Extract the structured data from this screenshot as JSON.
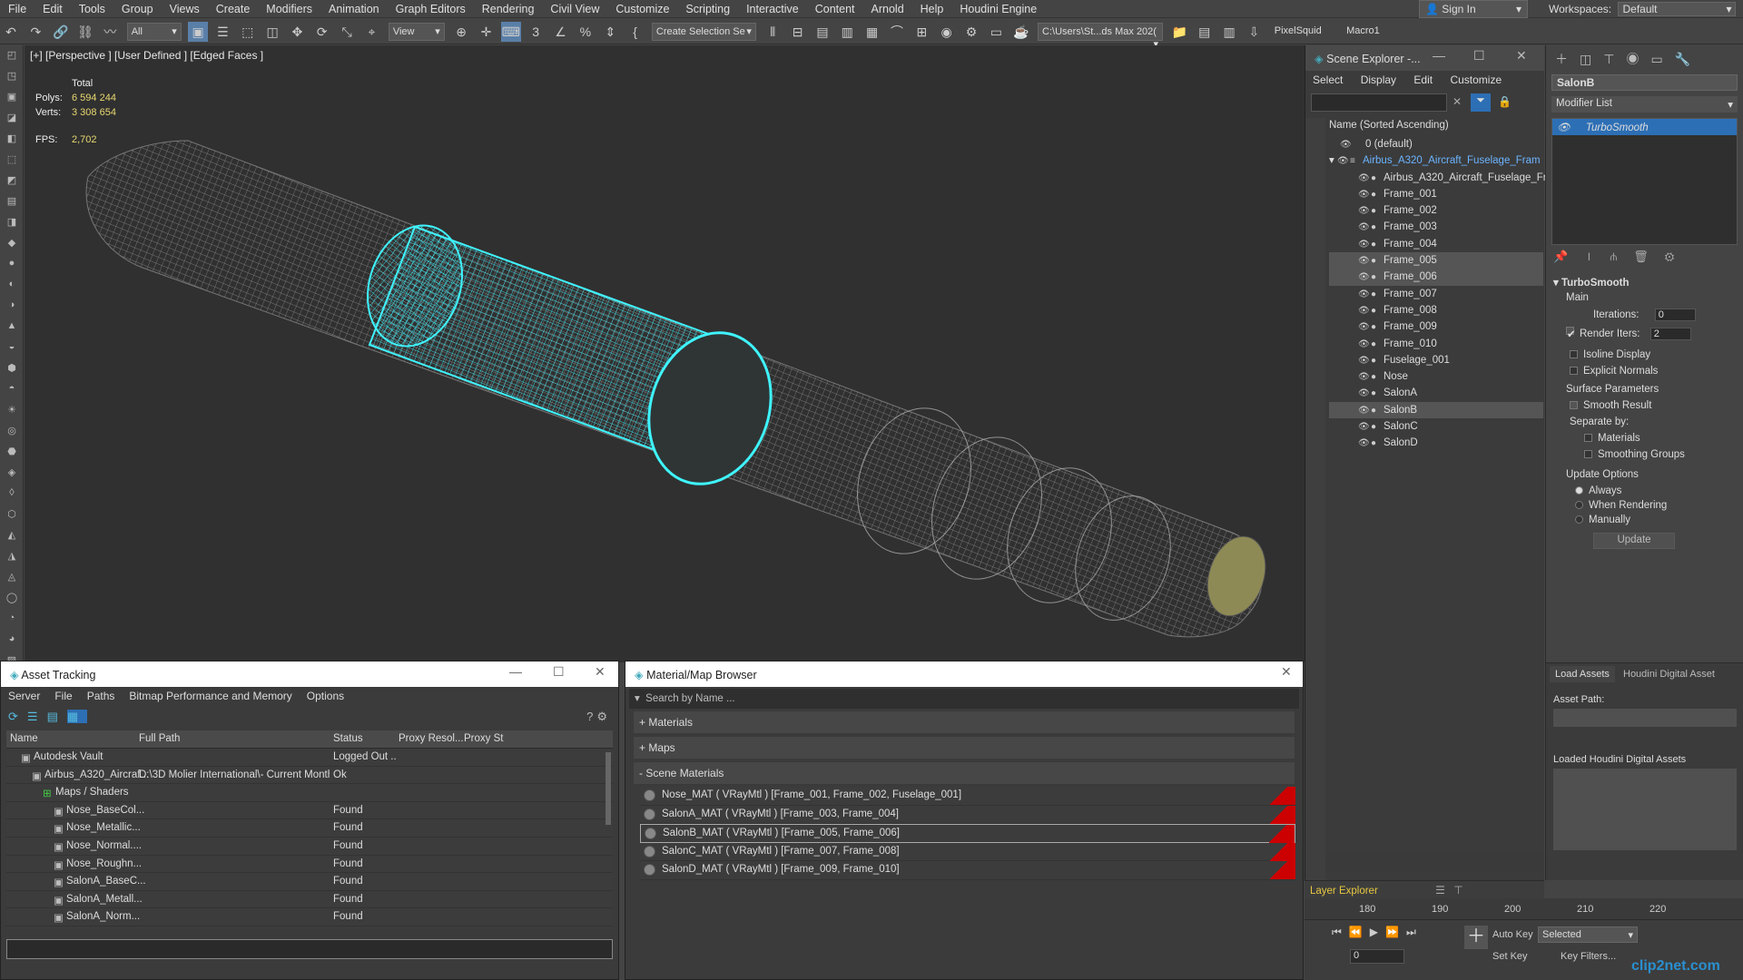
{
  "menu": [
    "File",
    "Edit",
    "Tools",
    "Group",
    "Views",
    "Create",
    "Modifiers",
    "Animation",
    "Graph Editors",
    "Rendering",
    "Civil View",
    "Customize",
    "Scripting",
    "Interactive",
    "Content",
    "Arnold",
    "Help",
    "Houdini Engine"
  ],
  "signin": "Sign In",
  "workspaces": {
    "label": "Workspaces:",
    "value": "Default"
  },
  "toolbar": {
    "filter": "All",
    "refcoord": "View",
    "selset": "Create Selection Se",
    "path": "C:\\Users\\St...ds Max 202(",
    "pixelsquid": "PixelSquid",
    "macro": "Macro1"
  },
  "viewport": {
    "label": "[+] [Perspective ] [User Defined ] [Edged Faces ]",
    "stats_title": "Total",
    "polys_label": "Polys:",
    "polys": "6 594 244",
    "verts_label": "Verts:",
    "verts": "3 308 654",
    "fps_label": "FPS:",
    "fps": "2,702"
  },
  "scene_explorer": {
    "title": "Scene Explorer -...",
    "menu": [
      "Select",
      "Display",
      "Edit",
      "Customize"
    ],
    "header": "Name (Sorted Ascending)",
    "rows": [
      {
        "name": "0 (default)",
        "indent": 0,
        "sel": false
      },
      {
        "name": "Airbus_A320_Aircraft_Fuselage_Fram",
        "indent": 0,
        "sel": false,
        "link": true
      },
      {
        "name": "Airbus_A320_Aircraft_Fuselage_Fr",
        "indent": 1,
        "sel": false
      },
      {
        "name": "Frame_001",
        "indent": 1,
        "sel": false
      },
      {
        "name": "Frame_002",
        "indent": 1,
        "sel": false
      },
      {
        "name": "Frame_003",
        "indent": 1,
        "sel": false
      },
      {
        "name": "Frame_004",
        "indent": 1,
        "sel": false
      },
      {
        "name": "Frame_005",
        "indent": 1,
        "sel": true
      },
      {
        "name": "Frame_006",
        "indent": 1,
        "sel": true
      },
      {
        "name": "Frame_007",
        "indent": 1,
        "sel": false
      },
      {
        "name": "Frame_008",
        "indent": 1,
        "sel": false
      },
      {
        "name": "Frame_009",
        "indent": 1,
        "sel": false
      },
      {
        "name": "Frame_010",
        "indent": 1,
        "sel": false
      },
      {
        "name": "Fuselage_001",
        "indent": 1,
        "sel": false
      },
      {
        "name": "Nose",
        "indent": 1,
        "sel": false
      },
      {
        "name": "SalonA",
        "indent": 1,
        "sel": false
      },
      {
        "name": "SalonB",
        "indent": 1,
        "sel": true
      },
      {
        "name": "SalonC",
        "indent": 1,
        "sel": false
      },
      {
        "name": "SalonD",
        "indent": 1,
        "sel": false
      }
    ],
    "layer_explorer": "Layer Explorer"
  },
  "command_panel": {
    "object_name": "SalonB",
    "modifier_list": "Modifier List",
    "modifier": "TurboSmooth",
    "rollout": "TurboSmooth",
    "main": "Main",
    "iterations_label": "Iterations:",
    "iterations": "0",
    "render_iters_label": "Render Iters:",
    "render_iters": "2",
    "isoline": "Isoline Display",
    "explicit": "Explicit Normals",
    "surface": "Surface Parameters",
    "smooth_result": "Smooth Result",
    "separate_by": "Separate by:",
    "materials": "Materials",
    "smoothing_groups": "Smoothing Groups",
    "update_options": "Update Options",
    "always": "Always",
    "when_rendering": "When Rendering",
    "manually": "Manually",
    "update_btn": "Update",
    "tabs": [
      "Load Assets",
      "Houdini Digital Asset"
    ],
    "asset_path": "Asset Path:",
    "loaded_hda": "Loaded Houdini Digital Assets"
  },
  "timeline": {
    "ticks": [
      "180",
      "190",
      "200",
      "210",
      "220"
    ],
    "autokey": "Auto Key",
    "selected": "Selected",
    "setkey": "Set Key",
    "keyfilters": "Key Filters...",
    "frame": "0"
  },
  "asset_tracking": {
    "title": "Asset Tracking",
    "menu": [
      "Server",
      "File",
      "Paths",
      "Bitmap Performance and Memory",
      "Options"
    ],
    "columns": [
      "Name",
      "Full Path",
      "Status",
      "Proxy Resol...",
      "Proxy St"
    ],
    "rows": [
      {
        "name": "Autodesk Vault",
        "path": "",
        "status": "Logged Out ...",
        "indent": 1
      },
      {
        "name": "Airbus_A320_Aircraf...",
        "path": "D:\\3D Molier International\\- Current Month -...",
        "status": "Ok",
        "indent": 2
      },
      {
        "name": "Maps / Shaders",
        "path": "",
        "status": "",
        "indent": 3
      },
      {
        "name": "Nose_BaseCol...",
        "path": "",
        "status": "Found",
        "indent": 4
      },
      {
        "name": "Nose_Metallic...",
        "path": "",
        "status": "Found",
        "indent": 4
      },
      {
        "name": "Nose_Normal....",
        "path": "",
        "status": "Found",
        "indent": 4
      },
      {
        "name": "Nose_Roughn...",
        "path": "",
        "status": "Found",
        "indent": 4
      },
      {
        "name": "SalonA_BaseC...",
        "path": "",
        "status": "Found",
        "indent": 4
      },
      {
        "name": "SalonA_Metall...",
        "path": "",
        "status": "Found",
        "indent": 4
      },
      {
        "name": "SalonA_Norm...",
        "path": "",
        "status": "Found",
        "indent": 4
      }
    ]
  },
  "material_browser": {
    "title": "Material/Map Browser",
    "search": "Search by Name ...",
    "sections": [
      "+ Materials",
      "+ Maps",
      "- Scene Materials"
    ],
    "materials": [
      {
        "label": "Nose_MAT  ( VRayMtl ) [Frame_001, Frame_002, Fuselage_001]",
        "sel": false
      },
      {
        "label": "SalonA_MAT  ( VRayMtl ) [Frame_003, Frame_004]",
        "sel": false
      },
      {
        "label": "SalonB_MAT  ( VRayMtl ) [Frame_005, Frame_006]",
        "sel": true
      },
      {
        "label": "SalonC_MAT  ( VRayMtl ) [Frame_007, Frame_008]",
        "sel": false
      },
      {
        "label": "SalonD_MAT  ( VRayMtl ) [Frame_009, Frame_010]",
        "sel": false
      }
    ]
  },
  "watermark": "clip2net.com",
  "colors": {
    "accent": "#3aa0e0",
    "selection": "#00e5ff",
    "highlight": "#2d6fb5"
  }
}
